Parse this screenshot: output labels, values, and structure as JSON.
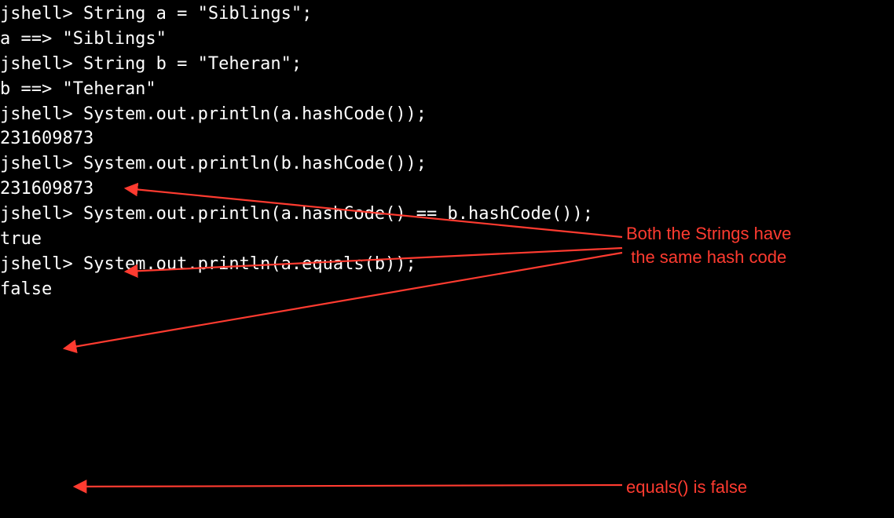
{
  "colors": {
    "annotation": "#ff3b30",
    "background": "#000000",
    "text": "#ffffff"
  },
  "terminal": {
    "lines": [
      "jshell> String a = \"Siblings\";",
      "a ==> \"Siblings\"",
      "",
      "jshell> String b = \"Teheran\";",
      "b ==> \"Teheran\"",
      "",
      "jshell> System.out.println(a.hashCode());",
      "231609873",
      "",
      "jshell> System.out.println(b.hashCode());",
      "231609873",
      "",
      "jshell> System.out.println(a.hashCode() == b.hashCode());",
      "true",
      "",
      "jshell> System.out.println(a.equals(b));",
      "false"
    ]
  },
  "annotations": {
    "hash_note_line1": "Both the Strings have",
    "hash_note_line2": "the same hash code",
    "equals_note": "equals() is false"
  }
}
